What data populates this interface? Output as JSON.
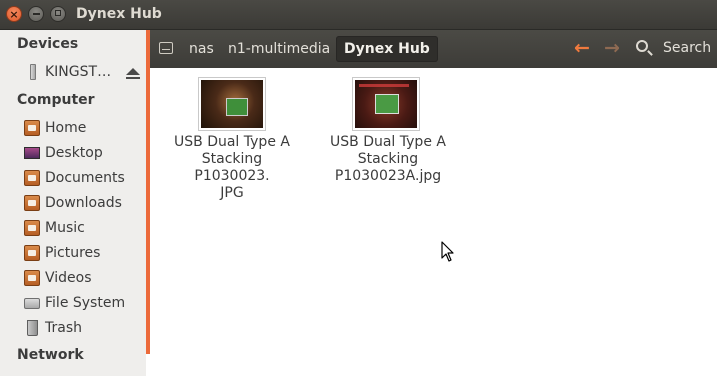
{
  "window": {
    "title": "Dynex Hub"
  },
  "sidebar": {
    "devices_heading": "Devices",
    "devices": [
      {
        "label": "KINGST…",
        "icon": "usb-drive-icon",
        "eject_icon": "eject-icon"
      }
    ],
    "computer_heading": "Computer",
    "places": [
      {
        "label": "Home",
        "icon": "home-folder-icon"
      },
      {
        "label": "Desktop",
        "icon": "desktop-icon"
      },
      {
        "label": "Documents",
        "icon": "documents-folder-icon"
      },
      {
        "label": "Downloads",
        "icon": "downloads-folder-icon"
      },
      {
        "label": "Music",
        "icon": "music-folder-icon"
      },
      {
        "label": "Pictures",
        "icon": "pictures-folder-icon"
      },
      {
        "label": "Videos",
        "icon": "videos-folder-icon"
      },
      {
        "label": "File System",
        "icon": "drive-icon"
      },
      {
        "label": "Trash",
        "icon": "trash-icon"
      }
    ],
    "network_heading": "Network"
  },
  "toolbar": {
    "breadcrumbs": [
      "nas",
      "n1-multimedia",
      "Dynex Hub"
    ],
    "search_label": "Search"
  },
  "files": [
    {
      "name": "USB Dual Type A Stacking P1030023.\nJPG",
      "line1": "USB Dual Type A",
      "line2": "Stacking P1030023.",
      "line3": "JPG"
    },
    {
      "name": "USB Dual Type A Stacking P1030023A.jpg",
      "line1": "USB Dual Type A",
      "line2": "Stacking",
      "line3": "P1030023A.jpg"
    }
  ],
  "colors": {
    "accent": "#ec6a3a",
    "toolbar": "#45443f",
    "sidebar": "#efeeec"
  }
}
